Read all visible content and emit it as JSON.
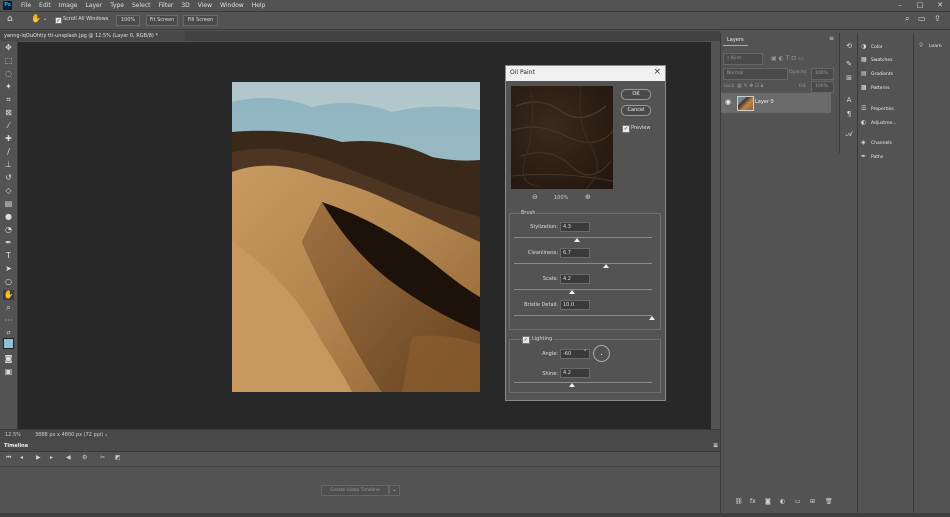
{
  "app": {
    "logo": "Ps"
  },
  "menu": [
    "File",
    "Edit",
    "Image",
    "Layer",
    "Type",
    "Select",
    "Filter",
    "3D",
    "View",
    "Window",
    "Help"
  ],
  "options": {
    "scroll_all": "Scroll All Windows",
    "zoom_100": "100%",
    "fit_screen": "Fit Screen",
    "fill_screen": "Fill Screen"
  },
  "document": {
    "tab_title": "yanng-lqOuOhtiy  tti-unsplash.jpg @ 12.5% (Layer 0, RGB/8) *",
    "zoom": "12.5%",
    "dimensions": "3888 px x 4800 px (72 ppi)"
  },
  "timeline": {
    "title": "Timeline",
    "create_button": "Create Video Timeline"
  },
  "layers_panel": {
    "tab": "Layers",
    "search_placeholder": "Kind",
    "blend_mode": "Normal",
    "opacity_label": "Opacity:",
    "opacity_value": "100%",
    "lock_label": "Lock:",
    "fill_label": "Fill:",
    "fill_value": "100%",
    "layer_name": "Layer 0"
  },
  "properties_panel": {
    "items": [
      "Color",
      "Swatches",
      "Gradients",
      "Patterns",
      "Properties",
      "Adjustme...",
      "Channels",
      "Paths"
    ]
  },
  "learn_panel": {
    "label": "Learn"
  },
  "dialog": {
    "title": "Oil Paint",
    "ok": "OK",
    "cancel": "Cancel",
    "preview_label": "Preview",
    "preview_checked": true,
    "zoom": "100%",
    "brush_label": "Brush",
    "stylization_label": "Stylization:",
    "stylization_value": "4.3",
    "stylization_level": 0.46,
    "cleanliness_label": "Cleanliness:",
    "cleanliness_value": "6.7",
    "cleanliness_level": 0.67,
    "scale_label": "Scale:",
    "scale_value": "4.2",
    "scale_level": 0.42,
    "bristle_label": "Bristle Detail:",
    "bristle_value": "10.0",
    "bristle_level": 1.0,
    "lighting_label": "Lighting",
    "lighting_checked": true,
    "angle_label": "Angle:",
    "angle_value": "-60",
    "angle_unit": "°",
    "shine_label": "Shine:",
    "shine_value": "4.2",
    "shine_level": 0.42
  }
}
